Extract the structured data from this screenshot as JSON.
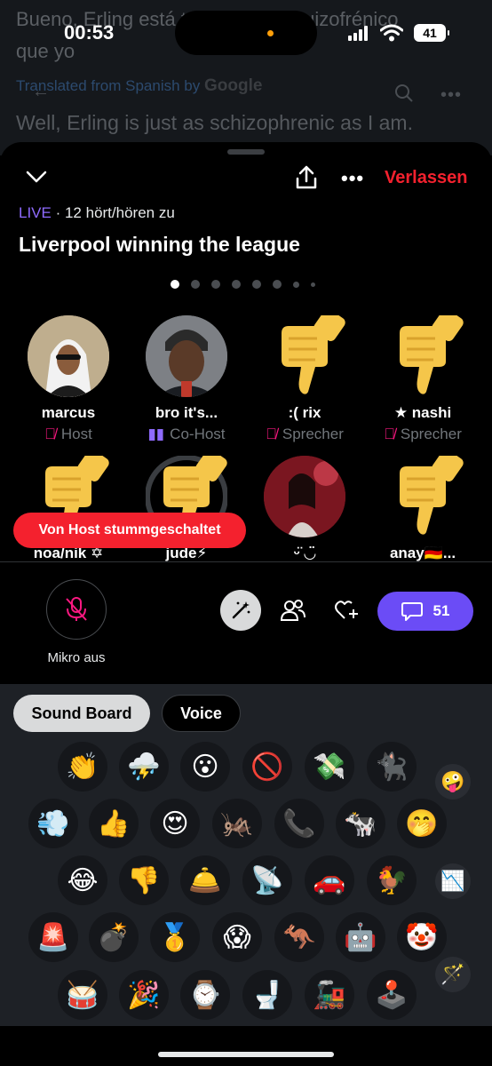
{
  "status_bar": {
    "time": "00:53",
    "battery": "41"
  },
  "background_tweet": {
    "line1": "Bueno, Erling está tan o más esquizofrénico",
    "line2": "que yo",
    "translated_prefix": "Translated from Spanish by",
    "translated_brand": "Google",
    "translation": "Well, Erling is just as schizophrenic as I am."
  },
  "space": {
    "leave_label": "Verlassen",
    "live_tag": "LIVE",
    "listeners": "· 12 hört/hören zu",
    "title": "Liverpool winning the league",
    "speakers": [
      {
        "name": "marcus",
        "role": "Host",
        "muted": true,
        "avatar": "photo"
      },
      {
        "name": "bro it's...",
        "role": "Co-Host",
        "muted": false,
        "avatar": "photo"
      },
      {
        "name": ":( rix",
        "role": "Sprecher",
        "muted": true,
        "avatar": "thumbs-down"
      },
      {
        "name": "★ nashi",
        "role": "Sprecher",
        "muted": true,
        "avatar": "thumbs-down"
      },
      {
        "name": "noa/nik ✡",
        "role": "",
        "avatar": "thumbs-down"
      },
      {
        "name": "jude⚡",
        "role": "",
        "avatar": "thumbs-down"
      },
      {
        "name": "ᵕ̈ ◡̈",
        "role": "",
        "avatar": "photo"
      },
      {
        "name": "anay🇩🇪...",
        "role": "",
        "avatar": "thumbs-down"
      }
    ],
    "toast": "Von Host stummgeschaltet",
    "mic_label": "Mikro aus",
    "comment_count": "51"
  },
  "sound_board": {
    "tabs": [
      "Sound Board",
      "Voice"
    ],
    "emojis": [
      "👏",
      "⛈️",
      "😮",
      "🚫",
      "💸",
      "🐈‍⬛",
      "🤪",
      "💨",
      "👍",
      "😍",
      "🦗",
      "📞",
      "🐄",
      "🤭",
      "😂",
      "👎",
      "🛎️",
      "📡",
      "🚗",
      "🐓",
      "📉",
      "🚨",
      "💣",
      "🥇",
      "😱",
      "🦘",
      "🤖",
      "🤡",
      "🥁",
      "🎉",
      "⌚",
      "🚽",
      "🚂",
      "🕹️",
      "🪄"
    ]
  }
}
